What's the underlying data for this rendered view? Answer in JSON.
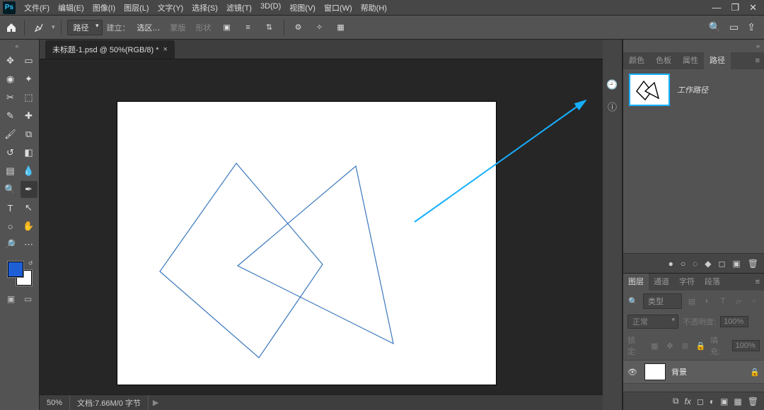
{
  "app": {
    "logo": "Ps"
  },
  "menu": {
    "items": [
      "文件(F)",
      "编辑(E)",
      "图像(I)",
      "图层(L)",
      "文字(Y)",
      "选择(S)",
      "滤镜(T)",
      "3D(D)",
      "视图(V)",
      "窗口(W)",
      "帮助(H)"
    ]
  },
  "window_controls": {
    "minimize": "—",
    "restore": "❐",
    "close": "✕"
  },
  "options_bar": {
    "mode_label": "路径",
    "make_label": "建立：",
    "btn_selection": "选区…",
    "btn_mask": "蒙版",
    "btn_shape": "形状",
    "right_icons": [
      "search-icon",
      "screen-mode-icon",
      "share-icon"
    ]
  },
  "document": {
    "tab_title": "未标题-1.psd @ 50%(RGB/8) *"
  },
  "status_bar": {
    "zoom": "50%",
    "doc_info": "文档:7.66M/0 字节"
  },
  "swatches": {
    "fg": "#1e5fd6",
    "bg": "#ffffff"
  },
  "paths_panel": {
    "tabs": [
      "颜色",
      "色板",
      "属性",
      "路径"
    ],
    "active_tab": "路径",
    "work_path_label": "工作路径",
    "footer_icons": [
      "fill-icon",
      "stroke-icon",
      "path-to-sel-icon",
      "sel-to-path-icon",
      "new-path-icon",
      "mask-icon",
      "trash-icon"
    ]
  },
  "layers_panel": {
    "tabs": [
      "图层",
      "通道",
      "字符",
      "段落"
    ],
    "active_tab": "图层",
    "filter_placeholder": "类型",
    "blend_mode": "正常",
    "opacity_label": "不透明度:",
    "opacity_value": "100%",
    "lock_label": "锁定:",
    "fill_label": "填充:",
    "fill_value": "100%",
    "layer": {
      "name": "背景"
    },
    "footer_icons": [
      "link-icon",
      "fx-icon",
      "mask-icon",
      "adjust-icon",
      "group-icon",
      "new-layer-icon",
      "trash-icon"
    ]
  },
  "annotation": {
    "color": "#17b0ff"
  }
}
